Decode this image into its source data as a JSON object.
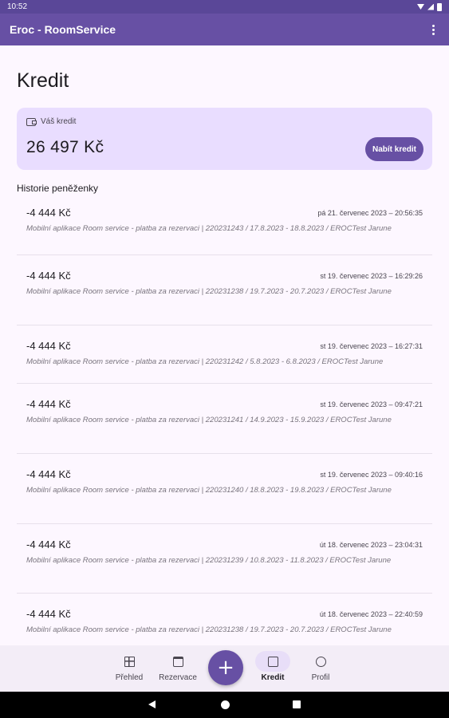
{
  "status_bar": {
    "time": "10:52"
  },
  "app_bar": {
    "title": "Eroc - RoomService"
  },
  "page": {
    "title": "Kredit"
  },
  "credit": {
    "label": "Váš kredit",
    "amount": "26 497 Kč",
    "charge_button": "Nabít kredit"
  },
  "history": {
    "title": "Historie peněženky",
    "items": [
      {
        "amount": "-4 444 Kč",
        "date": "pá 21. červenec 2023 – 20:56:35",
        "description": "Mobilní aplikace Room service - platba za rezervaci | 220231243 / 17.8.2023 - 18.8.2023 / EROCTest Jarune"
      },
      {
        "amount": "-4 444 Kč",
        "date": "st 19. červenec 2023 – 16:29:26",
        "description": "Mobilní aplikace Room service - platba za rezervaci | 220231238 / 19.7.2023 - 20.7.2023 / EROCTest Jarune"
      },
      {
        "amount": "-4 444 Kč",
        "date": "st 19. červenec 2023 – 16:27:31",
        "description": "Mobilní aplikace Room service - platba za rezervaci | 220231242 / 5.8.2023 - 6.8.2023 / EROCTest Jarune"
      },
      {
        "amount": "-4 444 Kč",
        "date": "st 19. červenec 2023 – 09:47:21",
        "description": "Mobilní aplikace Room service - platba za rezervaci | 220231241 / 14.9.2023 - 15.9.2023 / EROCTest Jarune"
      },
      {
        "amount": "-4 444 Kč",
        "date": "st 19. červenec 2023 – 09:40:16",
        "description": "Mobilní aplikace Room service - platba za rezervaci | 220231240 / 18.8.2023 - 19.8.2023 / EROCTest Jarune"
      },
      {
        "amount": "-4 444 Kč",
        "date": "út 18. červenec 2023 – 23:04:31",
        "description": "Mobilní aplikace Room service - platba za rezervaci | 220231239 / 10.8.2023 - 11.8.2023 / EROCTest Jarune"
      },
      {
        "amount": "-4 444 Kč",
        "date": "út 18. červenec 2023 – 22:40:59",
        "description": "Mobilní aplikace Room service - platba za rezervaci | 220231238 / 19.7.2023 - 20.7.2023 / EROCTest Jarune"
      }
    ]
  },
  "bottom_nav": {
    "items": [
      {
        "label": "Přehled",
        "icon": "dashboard-icon"
      },
      {
        "label": "Rezervace",
        "icon": "calendar-icon"
      },
      {
        "label": "Kredit",
        "icon": "credit-icon",
        "active": true
      },
      {
        "label": "Profil",
        "icon": "profile-icon"
      }
    ],
    "fab_label": "+"
  }
}
